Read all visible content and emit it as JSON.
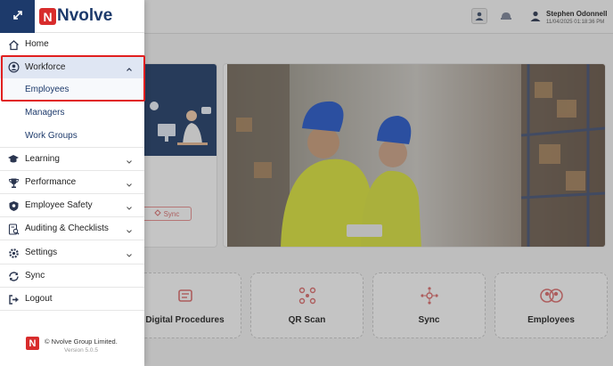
{
  "brand": {
    "logo_letter": "N",
    "name": "Nvolve"
  },
  "header": {
    "user_name": "Stephen Odonnell",
    "timestamp": "11/04/2025 01:18:36 PM"
  },
  "dashboard": {
    "sync_label": "Sync",
    "tiles": [
      {
        "label": "Digital Procedures",
        "icon": "procedures-icon"
      },
      {
        "label": "QR Scan",
        "icon": "qr-scan-icon"
      },
      {
        "label": "Sync",
        "icon": "sync-network-icon"
      },
      {
        "label": "Employees",
        "icon": "employees-icon"
      }
    ]
  },
  "sidebar": {
    "items": [
      {
        "label": "Home",
        "icon": "home-icon"
      },
      {
        "label": "Workforce",
        "icon": "user-circle-icon",
        "expanded": true,
        "children": [
          {
            "label": "Employees"
          },
          {
            "label": "Managers"
          },
          {
            "label": "Work Groups"
          }
        ]
      },
      {
        "label": "Learning",
        "icon": "graduation-cap-icon"
      },
      {
        "label": "Performance",
        "icon": "trophy-icon"
      },
      {
        "label": "Employee Safety",
        "icon": "shield-icon"
      },
      {
        "label": "Auditing & Checklists",
        "icon": "checklist-search-icon"
      },
      {
        "label": "Settings",
        "icon": "gear-icon"
      },
      {
        "label": "Sync",
        "icon": "sync-icon"
      },
      {
        "label": "Logout",
        "icon": "logout-icon"
      }
    ],
    "footer": {
      "logo_letter": "N",
      "copyright": "© Nvolve Group Limited.",
      "version": "Version 5.0.5"
    }
  },
  "colors": {
    "brand_navy": "#1d3a6b",
    "brand_red": "#d82c2c",
    "highlight_red": "#e11f1f",
    "active_bg": "#dfe6f3"
  }
}
